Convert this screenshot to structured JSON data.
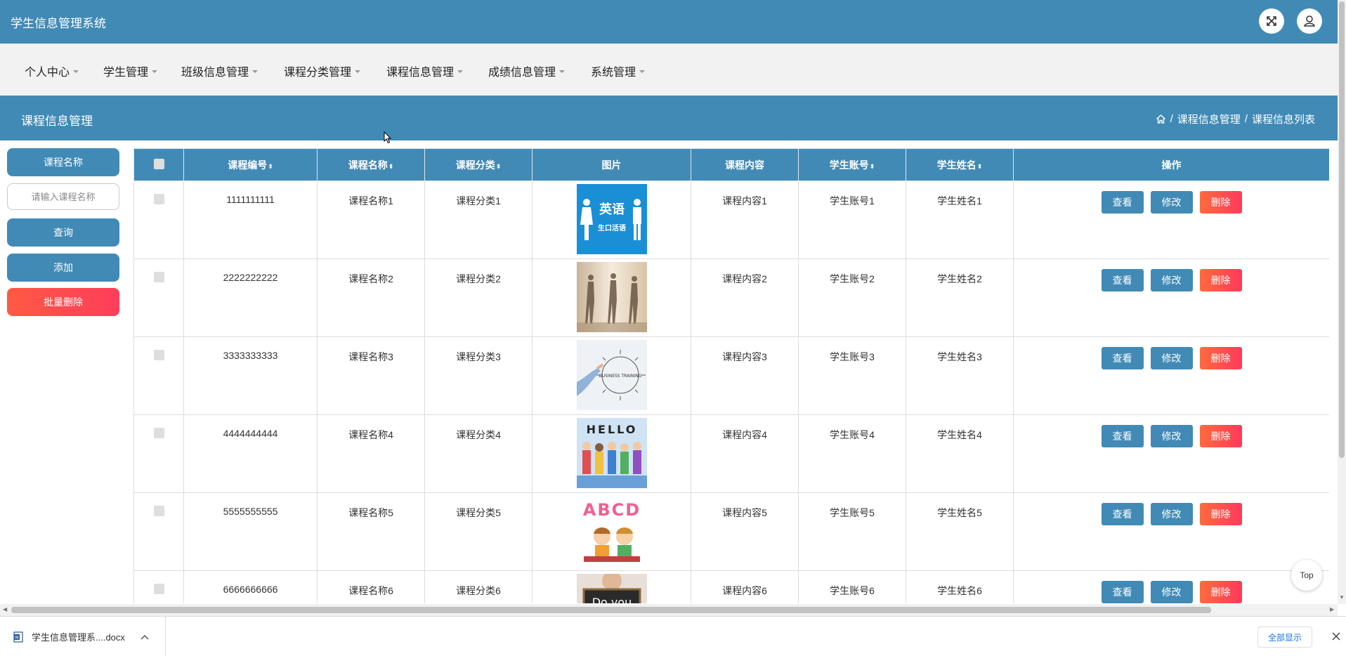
{
  "app": {
    "title": "学生信息管理系统"
  },
  "nav": {
    "items": [
      {
        "label": "个人中心"
      },
      {
        "label": "学生管理"
      },
      {
        "label": "班级信息管理"
      },
      {
        "label": "课程分类管理"
      },
      {
        "label": "课程信息管理"
      },
      {
        "label": "成绩信息管理"
      },
      {
        "label": "系统管理"
      }
    ]
  },
  "page": {
    "title": "课程信息管理",
    "breadcrumb": [
      "课程信息管理",
      "课程信息列表"
    ],
    "breadcrumb_sep": "/"
  },
  "sidebar": {
    "field_label": "课程名称",
    "search_placeholder": "请输入课程名称",
    "query_label": "查询",
    "add_label": "添加",
    "batch_delete_label": "批量删除"
  },
  "table": {
    "columns": [
      "课程编号",
      "课程名称",
      "课程分类",
      "图片",
      "课程内容",
      "学生账号",
      "学生姓名",
      "操作"
    ],
    "sort_indicator": "⬍",
    "rows": [
      {
        "id": "1111111111",
        "name": "课程名称1",
        "category": "课程分类1",
        "image": "english-poster",
        "content": "课程内容1",
        "account": "学生账号1",
        "student": "学生姓名1"
      },
      {
        "id": "2222222222",
        "name": "课程名称2",
        "category": "课程分类2",
        "image": "dance-silhouettes",
        "content": "课程内容2",
        "account": "学生账号2",
        "student": "学生姓名2"
      },
      {
        "id": "3333333333",
        "name": "课程名称3",
        "category": "课程分类3",
        "image": "business-training",
        "content": "课程内容3",
        "account": "学生账号3",
        "student": "学生姓名3"
      },
      {
        "id": "4444444444",
        "name": "课程名称4",
        "category": "课程分类4",
        "image": "hello-kids",
        "content": "课程内容4",
        "account": "学生账号4",
        "student": "学生姓名4"
      },
      {
        "id": "5555555555",
        "name": "课程名称5",
        "category": "课程分类5",
        "image": "abcd-kids",
        "content": "课程内容5",
        "account": "学生账号5",
        "student": "学生姓名5"
      },
      {
        "id": "6666666666",
        "name": "课程名称6",
        "category": "课程分类6",
        "image": "do-you-sign",
        "content": "课程内容6",
        "account": "学生账号6",
        "student": "学生姓名6"
      }
    ],
    "actions": {
      "view": "查看",
      "edit": "修改",
      "delete": "删除"
    }
  },
  "thumb_text": {
    "english_top": "英语",
    "english_bottom": "生口活语",
    "business": "BUSINESS TRAINING",
    "hello": "HELLO",
    "abcd": "ABCD",
    "doyou": "Do you"
  },
  "back_to_top": "Top",
  "download": {
    "filename": "学生信息管理系....docx",
    "show_all": "全部显示"
  },
  "colors": {
    "primary": "#418ab6",
    "danger": "#ff4a55",
    "nav_bg": "#f2f2f2"
  },
  "icons": [
    "fullscreen-icon",
    "user-icon",
    "home-icon",
    "word-file-icon",
    "chevron-up-icon",
    "close-icon"
  ]
}
